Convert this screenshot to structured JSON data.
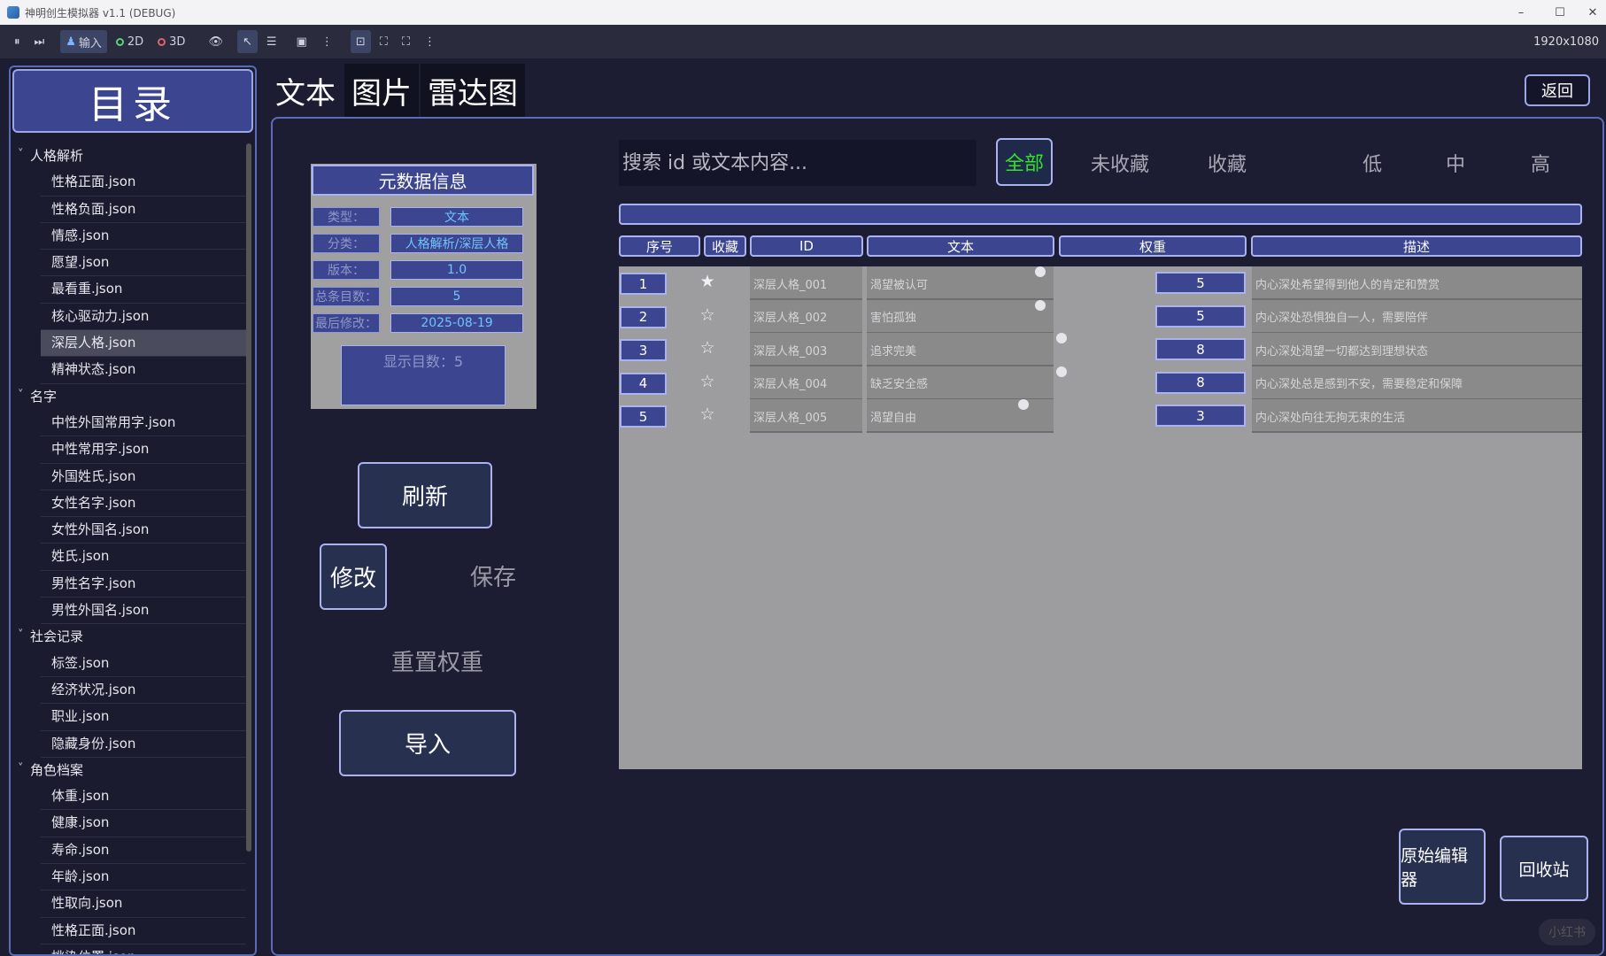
{
  "window": {
    "title": "神明创生模拟器 v1.1 (DEBUG)",
    "minimize": "–",
    "maximize": "☐",
    "close": "✕"
  },
  "toolbar": {
    "pause": "⏸",
    "step": "⏭",
    "input_label": "输入",
    "mode_2d": "2D",
    "mode_3d": "3D",
    "eye": "👁",
    "cursor": "↖",
    "list": "☰",
    "camera": "▣",
    "more": "⋮",
    "fit": "⊡",
    "expand1": "⛶",
    "expand2": "⛶",
    "more2": "⋮",
    "resolution": "1920x1080"
  },
  "sidebar": {
    "title": "目录",
    "tree": [
      {
        "type": "cat",
        "label": "人格解析"
      },
      {
        "type": "file",
        "label": "性格正面.json"
      },
      {
        "type": "file",
        "label": "性格负面.json"
      },
      {
        "type": "file",
        "label": "情感.json"
      },
      {
        "type": "file",
        "label": "愿望.json"
      },
      {
        "type": "file",
        "label": "最看重.json"
      },
      {
        "type": "file",
        "label": "核心驱动力.json"
      },
      {
        "type": "file",
        "label": "深层人格.json",
        "selected": true
      },
      {
        "type": "file",
        "label": "精神状态.json"
      },
      {
        "type": "cat",
        "label": "名字"
      },
      {
        "type": "file",
        "label": "中性外国常用字.json"
      },
      {
        "type": "file",
        "label": "中性常用字.json"
      },
      {
        "type": "file",
        "label": "外国姓氏.json"
      },
      {
        "type": "file",
        "label": "女性名字.json"
      },
      {
        "type": "file",
        "label": "女性外国名.json"
      },
      {
        "type": "file",
        "label": "姓氏.json"
      },
      {
        "type": "file",
        "label": "男性名字.json"
      },
      {
        "type": "file",
        "label": "男性外国名.json"
      },
      {
        "type": "cat",
        "label": "社会记录"
      },
      {
        "type": "file",
        "label": "标签.json"
      },
      {
        "type": "file",
        "label": "经济状况.json"
      },
      {
        "type": "file",
        "label": "职业.json"
      },
      {
        "type": "file",
        "label": "隐藏身份.json"
      },
      {
        "type": "cat",
        "label": "角色档案"
      },
      {
        "type": "file",
        "label": "体重.json"
      },
      {
        "type": "file",
        "label": "健康.json"
      },
      {
        "type": "file",
        "label": "寿命.json"
      },
      {
        "type": "file",
        "label": "年龄.json"
      },
      {
        "type": "file",
        "label": "性取向.json"
      },
      {
        "type": "file",
        "label": "性格正面.json"
      },
      {
        "type": "file",
        "label": "挑染位置.json"
      }
    ]
  },
  "tabs": [
    {
      "label": "文本",
      "active": true
    },
    {
      "label": "图片",
      "active": false
    },
    {
      "label": "雷达图",
      "active": false
    }
  ],
  "back_button": "返回",
  "metadata": {
    "title": "元数据信息",
    "rows": [
      {
        "key": "类型：",
        "value": "文本"
      },
      {
        "key": "分类：",
        "value": "人格解析/深层人格"
      },
      {
        "key": "版本：",
        "value": "1.0"
      },
      {
        "key": "总条目数：",
        "value": "5"
      },
      {
        "key": "最后修改：",
        "value": "2025-08-19"
      }
    ],
    "display_count": "显示目数：5"
  },
  "actions": {
    "refresh": "刷新",
    "edit": "修改",
    "save": "保存",
    "reset_weight": "重置权重",
    "import": "导入",
    "raw_editor": "原始编辑器",
    "recycle_bin": "回收站"
  },
  "search": {
    "placeholder": "搜索 id 或文本内容..."
  },
  "filters": {
    "all": "全部",
    "unfavorited": "未收藏",
    "favorited": "收藏",
    "low": "低",
    "mid": "中",
    "high": "高",
    "active_color": "#34e02c"
  },
  "table": {
    "headers": {
      "num": "序号",
      "fav": "收藏",
      "id": "ID",
      "text": "文本",
      "weight": "权重",
      "desc": "描述"
    },
    "rows": [
      {
        "num": "1",
        "fav": "★",
        "id": "深层人格_001",
        "text": "渴望被认可",
        "weight": "5",
        "desc": "内心深处希望得到他人的肯定和赞赏"
      },
      {
        "num": "2",
        "fav": "☆",
        "id": "深层人格_002",
        "text": "害怕孤独",
        "weight": "5",
        "desc": "内心深处恐惧独自一人，需要陪伴"
      },
      {
        "num": "3",
        "fav": "☆",
        "id": "深层人格_003",
        "text": "追求完美",
        "weight": "8",
        "desc": "内心深处渴望一切都达到理想状态"
      },
      {
        "num": "4",
        "fav": "☆",
        "id": "深层人格_004",
        "text": "缺乏安全感",
        "weight": "8",
        "desc": "内心深处总是感到不安，需要稳定和保障"
      },
      {
        "num": "5",
        "fav": "☆",
        "id": "深层人格_005",
        "text": "渴望自由",
        "weight": "3",
        "desc": "内心深处向往无拘无束的生活"
      }
    ]
  },
  "watermark": "小红书",
  "colors": {
    "accent": "#3c4590",
    "border": "#aab3f0",
    "background": "#1c1d33"
  }
}
